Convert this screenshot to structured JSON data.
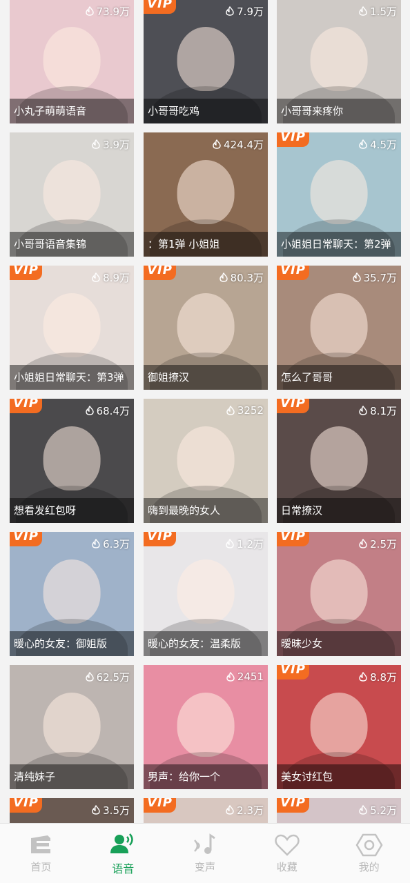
{
  "cards": [
    {
      "caption": "小丸子萌萌语音",
      "views": "73.9万",
      "vip": false,
      "bg": "#e9c9cf"
    },
    {
      "caption": "小哥哥吃鸡",
      "views": "7.9万",
      "vip": true,
      "bg": "#4e4f55"
    },
    {
      "caption": "小哥哥来疼你",
      "views": "1.5万",
      "vip": false,
      "bg": "#cfcac6"
    },
    {
      "caption": "小哥哥语音集锦",
      "views": "3.9万",
      "vip": false,
      "bg": "#d8d6d2"
    },
    {
      "caption": "：第1弹          小姐姐",
      "views": "424.4万",
      "vip": false,
      "bg": "#8a6a52"
    },
    {
      "caption": "小姐姐日常聊天：第2弹",
      "views": "4.5万",
      "vip": true,
      "bg": "#a7c5cf"
    },
    {
      "caption": "小姐姐日常聊天：第3弹",
      "views": "8.9万",
      "vip": true,
      "bg": "#e6ddd9"
    },
    {
      "caption": "御姐撩汉",
      "views": "80.3万",
      "vip": true,
      "bg": "#b7a593"
    },
    {
      "caption": "怎么了哥哥",
      "views": "35.7万",
      "vip": true,
      "bg": "#a88b7b"
    },
    {
      "caption": "想看发红包呀",
      "views": "68.4万",
      "vip": true,
      "bg": "#4b4a4c"
    },
    {
      "caption": "嗨到最晚的女人",
      "views": "3252",
      "vip": false,
      "bg": "#d4ccc0"
    },
    {
      "caption": "日常撩汉",
      "views": "8.1万",
      "vip": true,
      "bg": "#5a4b49"
    },
    {
      "caption": "暖心的女友：御姐版",
      "views": "6.3万",
      "vip": true,
      "bg": "#9fb2c9"
    },
    {
      "caption": "暖心的女友：温柔版",
      "views": "1.2万",
      "vip": true,
      "bg": "#e8e6e8"
    },
    {
      "caption": "暧昧少女",
      "views": "2.5万",
      "vip": true,
      "bg": "#c27f86"
    },
    {
      "caption": "清纯妹子",
      "views": "62.5万",
      "vip": false,
      "bg": "#bdb5b1"
    },
    {
      "caption": "男声：给你一个",
      "views": "2451",
      "vip": false,
      "bg": "#e88ea3"
    },
    {
      "caption": "美女讨红包",
      "views": "8.8万",
      "vip": true,
      "bg": "#c84b4e"
    },
    {
      "caption": "",
      "views": "3.5万",
      "vip": true,
      "bg": "#6a5a52"
    },
    {
      "caption": "",
      "views": "2.3万",
      "vip": true,
      "bg": "#d8c7c0"
    },
    {
      "caption": "",
      "views": "5.2万",
      "vip": true,
      "bg": "#d4c4c8"
    }
  ],
  "vip_label": "VIP",
  "tabs": [
    {
      "label": "首页",
      "icon": "home-icon",
      "active": false
    },
    {
      "label": "语音",
      "icon": "voice-user-icon",
      "active": true
    },
    {
      "label": "变声",
      "icon": "voice-change-icon",
      "active": false
    },
    {
      "label": "收藏",
      "icon": "heart-icon",
      "active": false
    },
    {
      "label": "我的",
      "icon": "hexagon-icon",
      "active": false
    }
  ],
  "colors": {
    "accent": "#18a058",
    "vip": "#f36c21",
    "inactive": "#b7b7b7"
  }
}
